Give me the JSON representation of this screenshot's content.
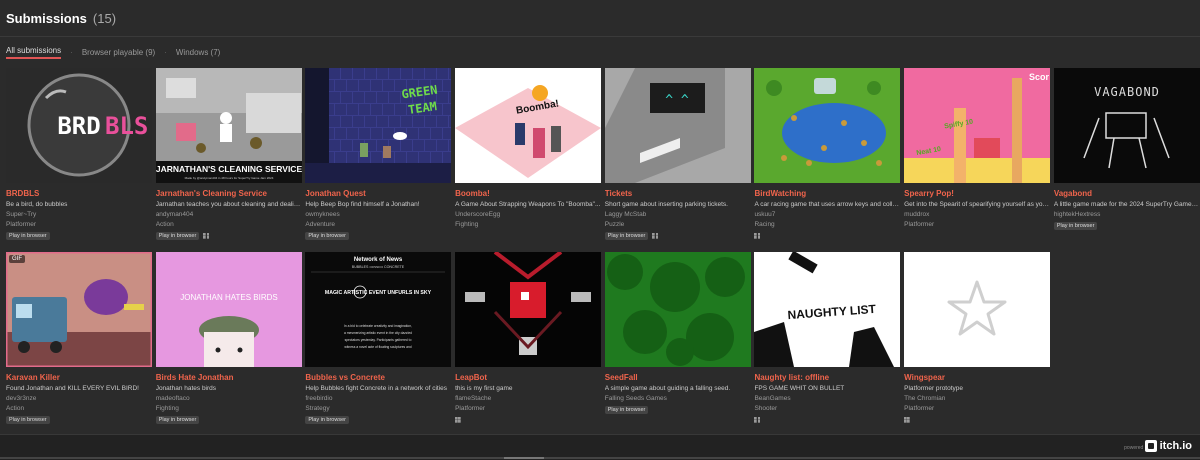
{
  "header": {
    "title": "Submissions",
    "count": "(15)"
  },
  "filters": [
    {
      "label": "All submissions",
      "active": true
    },
    {
      "label": "Browser playable (9)",
      "active": false
    },
    {
      "label": "Windows (7)",
      "active": false
    }
  ],
  "filter_separator": "·",
  "play_in_browser_label": "Play in browser",
  "submissions": [
    {
      "title": "BRDBLS",
      "desc": "Be a bird, do bubbles",
      "author": "Super~Try",
      "genre": "Platformer",
      "browser": true,
      "windows": false,
      "thumb": "brdbls",
      "gif": false,
      "thumb_text": "BRDBLS"
    },
    {
      "title": "Jarnathan's Cleaning Service",
      "desc": "Jarnathan teaches you about cleaning and dealing with the undesirables",
      "author": "andyman404",
      "genre": "Action",
      "browser": true,
      "windows": true,
      "thumb": "cleaning",
      "gif": false,
      "thumb_text": "JARNATHAN'S CLEANING SERVICE",
      "thumb_sub": "Made by @andyman404 in 48 hours for SuperTry Game Jam 2024"
    },
    {
      "title": "Jonathan Quest",
      "desc": "Help Beep Bop find himself a Jonathan!",
      "author": "owmyknees",
      "genre": "Adventure",
      "browser": true,
      "windows": false,
      "thumb": "quest",
      "gif": false,
      "thumb_text": "GREEN TEAM"
    },
    {
      "title": "Boomba!",
      "desc": "A Game About Strapping Weapons To \"Boomba\"...",
      "author": "UnderscoreEgg",
      "genre": "Fighting",
      "browser": false,
      "windows": false,
      "thumb": "boomba",
      "gif": false,
      "thumb_text": "Boomba!"
    },
    {
      "title": "Tickets",
      "desc": "Short game about inserting parking tickets.",
      "author": "Laggy McStab",
      "genre": "Puzzle",
      "browser": true,
      "windows": true,
      "thumb": "tickets",
      "gif": false,
      "thumb_text": "^ ^"
    },
    {
      "title": "BirdWatching",
      "desc": "A car racing game that uses arrow keys and collects birds",
      "author": "uskuu7",
      "genre": "Racing",
      "browser": false,
      "windows": true,
      "thumb": "birdwatching",
      "gif": false
    },
    {
      "title": "Spearry Pop!",
      "desc": "Get into the Spearit of spearifying yourself as you pop",
      "author": "muddrox",
      "genre": "Platformer",
      "browser": false,
      "windows": false,
      "thumb": "spearry",
      "gif": false,
      "thumb_text": "Spiffy 10",
      "thumb_text2": "Neat 10",
      "thumb_text3": "Scor"
    },
    {
      "title": "Vagabond",
      "desc": "A little game made for the 2024 SuperTry Game Jam",
      "author": "hightekHextress",
      "genre": "",
      "browser": true,
      "windows": false,
      "thumb": "vagabond",
      "gif": false,
      "thumb_text": "VAGABOND"
    },
    {
      "title": "Karavan Killer",
      "desc": "Found Jonathan and KILL EVERY EVIL BIRD!",
      "author": "dev3r3nze",
      "genre": "Action",
      "browser": true,
      "windows": false,
      "thumb": "karavan",
      "gif": true,
      "gif_label": "GIF"
    },
    {
      "title": "Birds Hate Jonathan",
      "desc": "Jonathan hates birds",
      "author": "madeoftaco",
      "genre": "Fighting",
      "browser": true,
      "windows": false,
      "thumb": "birdshate",
      "gif": false,
      "thumb_text": "JONATHAN HATES BIRDS"
    },
    {
      "title": "Bubbles vs Concrete",
      "desc": "Help Bubbles fight Concrete in a network of cities",
      "author": "freebirdio",
      "genre": "Strategy",
      "browser": true,
      "windows": false,
      "thumb": "bubbles",
      "gif": false,
      "thumb_text": "Network of News",
      "thumb_text2": "BUBBLES ••••vs•••• CONCRETE",
      "thumb_text3": "MAGIC ARTISTIC EVENT UNFURLS IN SKY",
      "thumb_text4": "In a bid to celebrate creativity and imagination, a mesmerizing artistic event in the city dazzled spectators yesterday. Participants gathered to witness a novel acte of floating sculptures and colorful vibrant painted in a shared ethereal"
    },
    {
      "title": "LeapBot",
      "desc": "this is my first game",
      "author": "flameStache",
      "genre": "Platformer",
      "browser": false,
      "windows": true,
      "thumb": "leapbot",
      "gif": false
    },
    {
      "title": "SeedFall",
      "desc": "A simple game about guiding a falling seed.",
      "author": "Falling Seeds Games",
      "genre": "",
      "browser": true,
      "windows": false,
      "thumb": "seedfall",
      "gif": false
    },
    {
      "title": "Naughty list: offline",
      "desc": "FPS GAME WHIT ON BULLET",
      "author": "BeanGames",
      "genre": "Shooter",
      "browser": false,
      "windows": true,
      "thumb": "naughty",
      "gif": false,
      "thumb_text": "NAUGHTY LIST"
    },
    {
      "title": "Wingspear",
      "desc": "Platformer prototype",
      "author": "The Chromian",
      "genre": "Platformer",
      "browser": false,
      "windows": true,
      "thumb": "wingspear",
      "gif": false
    }
  ],
  "footer": {
    "powered_by": "powered by",
    "logo_text": "itch.io"
  },
  "colors": {
    "background": "#2b2b2b",
    "accent": "#f0644c",
    "active_underline": "#e05555"
  }
}
